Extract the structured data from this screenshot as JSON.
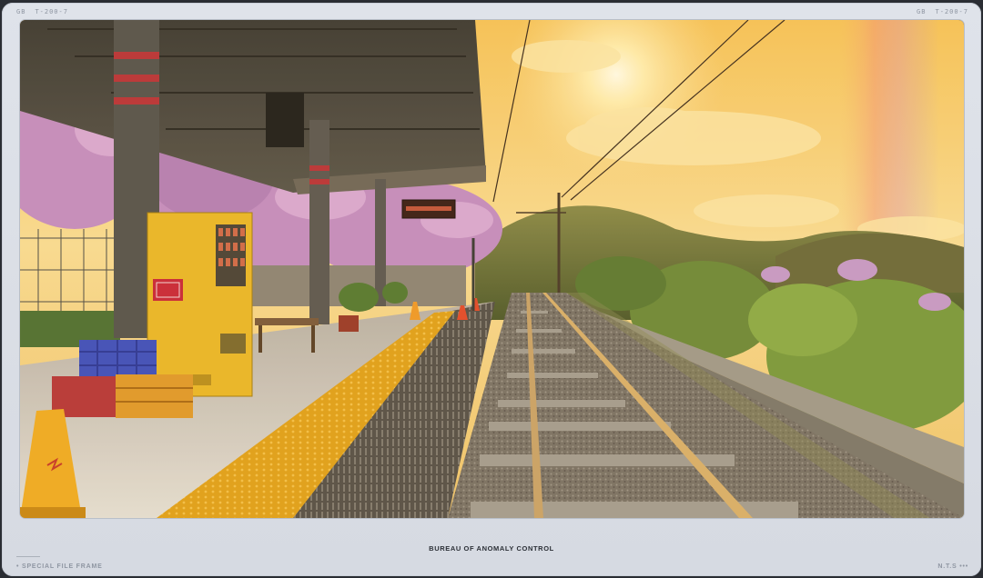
{
  "header": {
    "left_label": "GB",
    "left_code": "T-200-7",
    "right_label": "GB",
    "right_code": "T-200-7"
  },
  "scene": {
    "station_sign": "",
    "vending_label": "",
    "icons": [
      "cone-icon",
      "vending-machine",
      "crate"
    ]
  },
  "footer": {
    "title": "BUREAU OF ANOMALY CONTROL",
    "left_text": "• SPECIAL FILE FRAME",
    "right_text": "N.T.S •••"
  },
  "colors": {
    "frame": "#dfe3ea",
    "sky_glow": "#f7d27a",
    "tactile_yellow": "#e3a21a",
    "cherry_pink": "#c98fc6",
    "vending_yellow": "#e9b72a"
  }
}
